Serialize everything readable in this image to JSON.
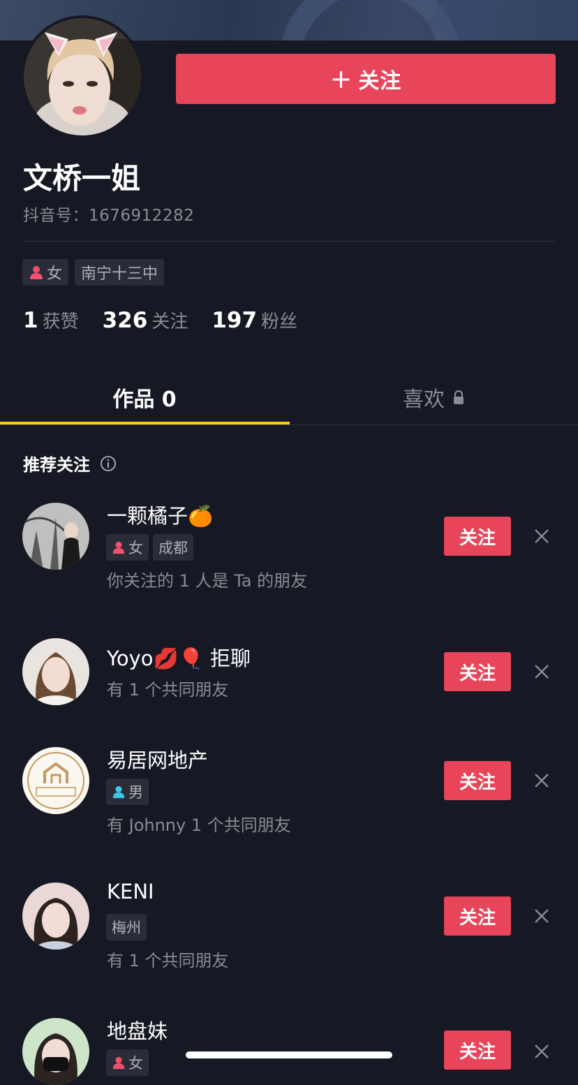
{
  "profile": {
    "follow_label": "关注",
    "name": "文桥一姐",
    "douyin_id": "抖音号：1676912282",
    "tags": [
      {
        "gender_icon": "female-icon",
        "label": "女"
      },
      {
        "label": "南宁十三中"
      }
    ],
    "stats": [
      {
        "num": "1",
        "label": "获赞"
      },
      {
        "num": "326",
        "label": "关注"
      },
      {
        "num": "197",
        "label": "粉丝"
      }
    ]
  },
  "tabs": {
    "works": "作品 0",
    "likes": "喜欢"
  },
  "recommend": {
    "title": "推荐关注",
    "follow_label": "关注",
    "items": [
      {
        "name": "一颗橘子🍊",
        "tags": [
          "女",
          "成都"
        ],
        "desc": "你关注的 1 人是 Ta 的朋友"
      },
      {
        "name": "Yoyo💋🎈 拒聊",
        "tags": [],
        "desc": "有 1 个共同朋友"
      },
      {
        "name": "易居网地产",
        "tags": [
          "男"
        ],
        "desc": "有 Johnny 1 个共同朋友"
      },
      {
        "name": "KENI",
        "tags": [
          "梅州"
        ],
        "desc": "有 1 个共同朋友"
      },
      {
        "name": "地盘妹",
        "tags": [
          "女"
        ],
        "desc": ""
      }
    ]
  },
  "colors": {
    "background": "#161823",
    "accent_red": "#e8445a",
    "tab_underline": "#face15",
    "female": "#f0506e",
    "male": "#3ec6e8"
  }
}
